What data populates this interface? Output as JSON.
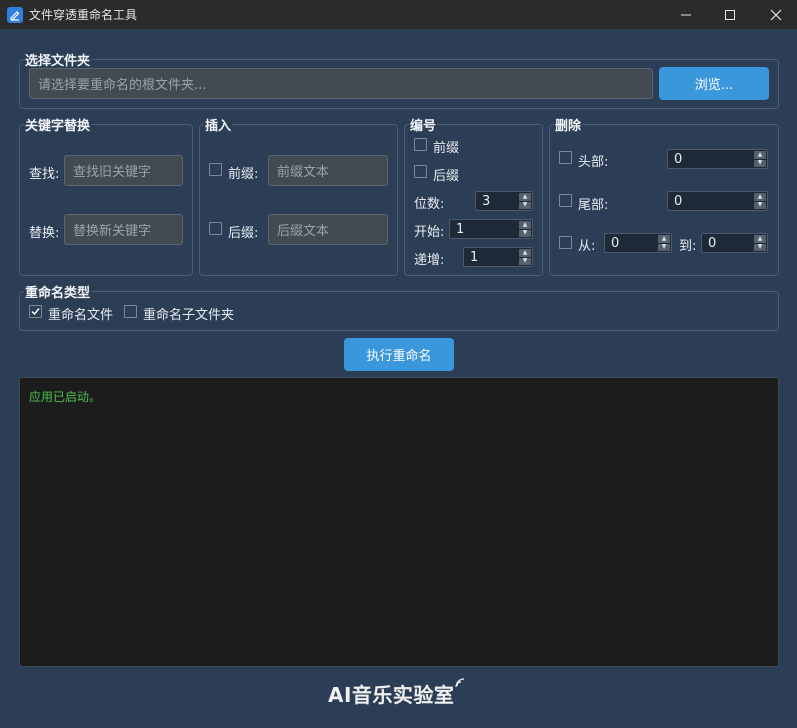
{
  "window": {
    "title": "文件穿透重命名工具",
    "controls": {
      "minimize": "—",
      "maximize": "☐",
      "close": "✕"
    }
  },
  "folder_select": {
    "group_title": "选择文件夹",
    "path_placeholder": "请选择要重命名的根文件夹...",
    "browse_label": "浏览..."
  },
  "keyword_replace": {
    "group_title": "关键字替换",
    "find_label": "查找:",
    "find_placeholder": "查找旧关键字",
    "replace_label": "替换:",
    "replace_placeholder": "替换新关键字"
  },
  "insert": {
    "group_title": "插入",
    "prefix_label": "前缀:",
    "prefix_placeholder": "前缀文本",
    "suffix_label": "后缀:",
    "suffix_placeholder": "后缀文本"
  },
  "numbering": {
    "group_title": "编号",
    "prefix_label": "前缀",
    "suffix_label": "后缀",
    "digits_label": "位数:",
    "digits_value": "3",
    "start_label": "开始:",
    "start_value": "1",
    "step_label": "递增:",
    "step_value": "1"
  },
  "delete": {
    "group_title": "删除",
    "head_label": "头部:",
    "head_value": "0",
    "tail_label": "尾部:",
    "tail_value": "0",
    "from_label": "从:",
    "from_value": "0",
    "to_label": "到:",
    "to_value": "0"
  },
  "rename_type": {
    "group_title": "重命名类型",
    "files_label": "重命名文件",
    "files_checked": true,
    "subfolders_label": "重命名子文件夹",
    "subfolders_checked": false
  },
  "execute_label": "执行重命名",
  "log": {
    "lines": [
      "应用已启动。"
    ],
    "text_color": "#4cc24c"
  },
  "watermark": "AI音乐实验室",
  "colors": {
    "background": "#2c3e55",
    "accent": "#3b97dc",
    "titlebar": "#2b2b2b",
    "log_bg": "#1c1c1c"
  }
}
